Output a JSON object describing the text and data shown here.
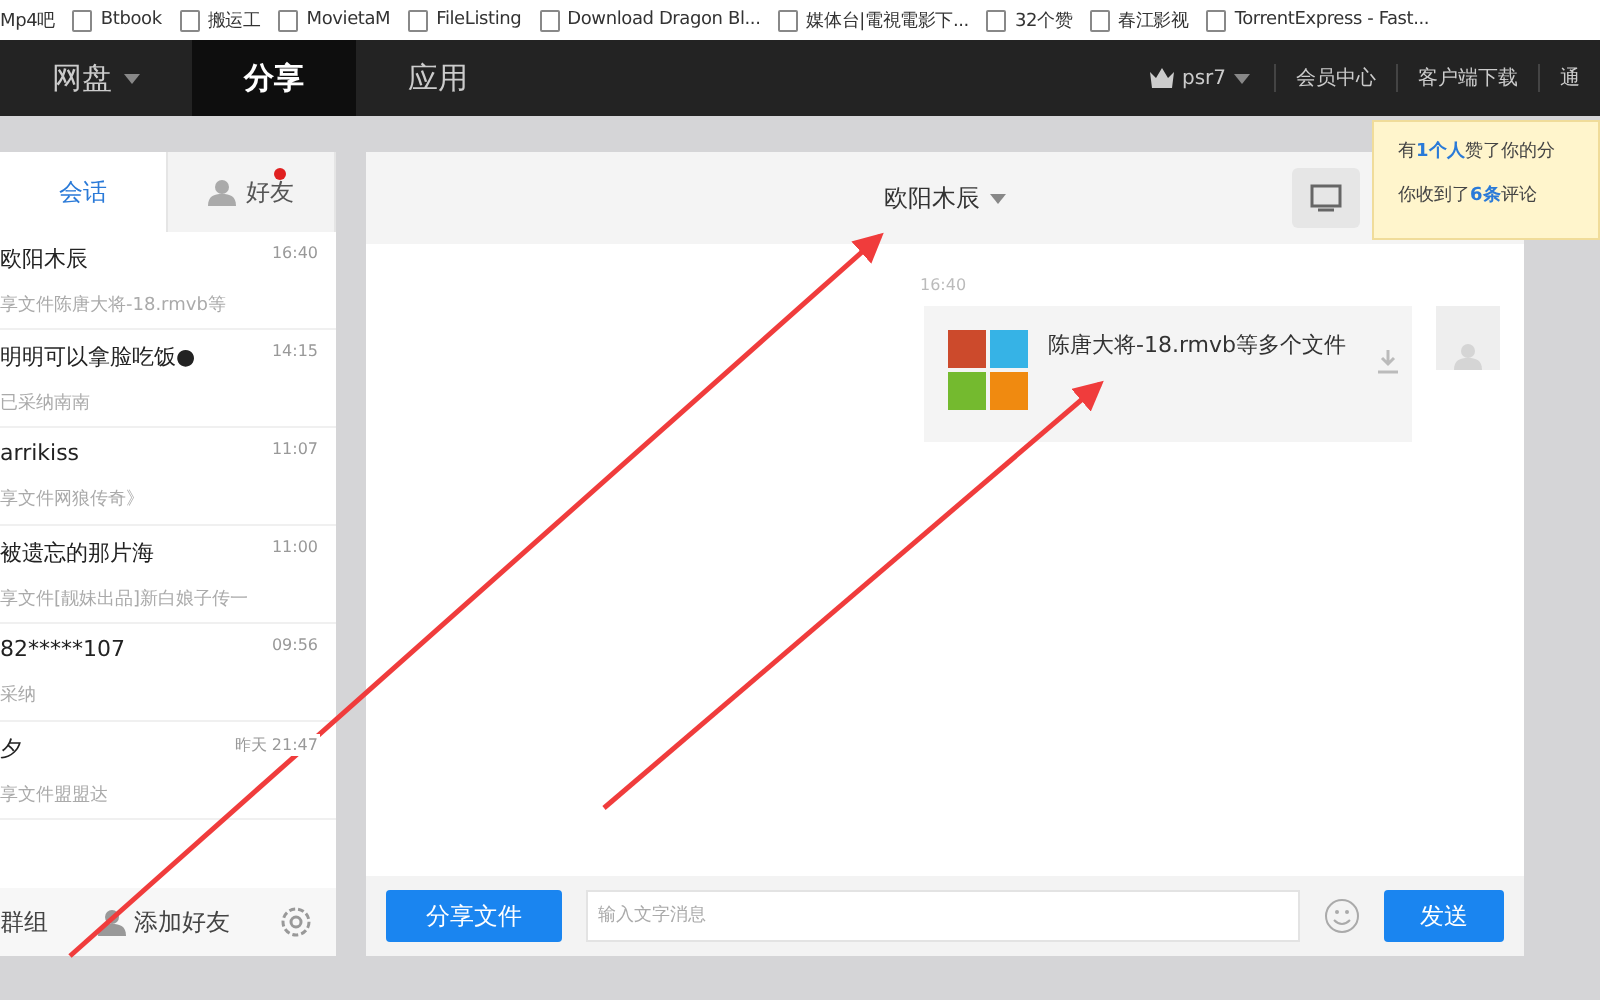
{
  "bookmarks": [
    "Mp4吧",
    "Btbook",
    "搬运工",
    "MovietaM",
    "FileListing",
    "Download Dragon Bl...",
    "媒体台|電視電影下...",
    "32个赞",
    "春江影视",
    "TorrentExpress - Fast..."
  ],
  "nav": {
    "tabs": [
      {
        "label": "网盘",
        "selected": false,
        "dropdown": true
      },
      {
        "label": "分享",
        "selected": true,
        "dropdown": false
      },
      {
        "label": "应用",
        "selected": false,
        "dropdown": false
      }
    ],
    "user": "psr7",
    "links": [
      "会员中心",
      "客户端下载",
      "通"
    ]
  },
  "notice": [
    "有**1个人**赞了你的分",
    "你收到了**6条**评论"
  ],
  "sidebar": {
    "tabs": [
      {
        "label": "会话",
        "selected": true,
        "badge": false
      },
      {
        "label": "好友",
        "selected": false,
        "badge": true
      }
    ],
    "conversations": [
      {
        "name": "欧阳木辰",
        "preview": "享文件陈唐大将-18.rmvb等",
        "time": "16:40"
      },
      {
        "name": "明明可以拿脸吃饭●",
        "preview": "已采纳南南",
        "time": "14:15"
      },
      {
        "name": "arrikiss",
        "preview": "享文件网狼传奇》",
        "time": "11:07"
      },
      {
        "name": "被遗忘的那片海",
        "preview": "享文件[靓妹出品]新白娘子传一",
        "time": "11:00"
      },
      {
        "name": "82*****107",
        "preview": "采纳",
        "time": "09:56"
      },
      {
        "name": "夕",
        "preview": "享文件盟盟达",
        "time": "昨天 21:47"
      }
    ],
    "footer": [
      "群组",
      "添加好友"
    ]
  },
  "chat": {
    "title": "欧阳木辰",
    "messages": [
      {
        "time": "16:40",
        "file": "陈唐大将-18.rmvb等多个文件"
      }
    ],
    "share_button": "分享文件",
    "input": {
      "placeholder": "输入文字消息"
    },
    "send_button": "发送"
  }
}
